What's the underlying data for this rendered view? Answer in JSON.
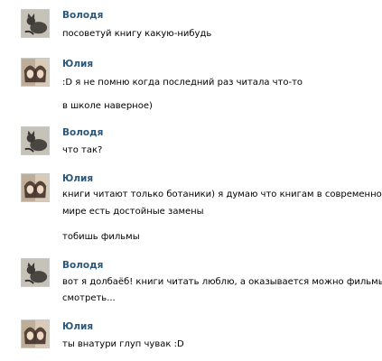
{
  "messages": [
    {
      "author": "Володя",
      "avatar_icon": "cat-silhouette-icon",
      "lines": [
        "посоветуй книгу какую-нибудь"
      ]
    },
    {
      "author": "Юлия",
      "avatar_icon": "girl-photo-icon",
      "lines": [
        ":D я не помню когда последний раз читала что-то",
        "в школе наверное)"
      ]
    },
    {
      "author": "Володя",
      "avatar_icon": "cat-silhouette-icon",
      "lines": [
        "что так?"
      ]
    },
    {
      "author": "Юлия",
      "avatar_icon": "girl-photo-icon",
      "lines": [
        "книги читают только ботаники) я думаю что книгам в современном",
        "мире есть достойные замены",
        "тобишь фильмы"
      ]
    },
    {
      "author": "Володя",
      "avatar_icon": "cat-silhouette-icon",
      "lines": [
        "вот я долбаёб! книги читать люблю, а оказывается можно фильмы",
        "смотреть..."
      ]
    },
    {
      "author": "Юлия",
      "avatar_icon": "girl-photo-icon",
      "lines": [
        "ты внатури глуп чувак :D"
      ]
    }
  ],
  "colors": {
    "author_name": "#2b587a",
    "text": "#000000"
  }
}
